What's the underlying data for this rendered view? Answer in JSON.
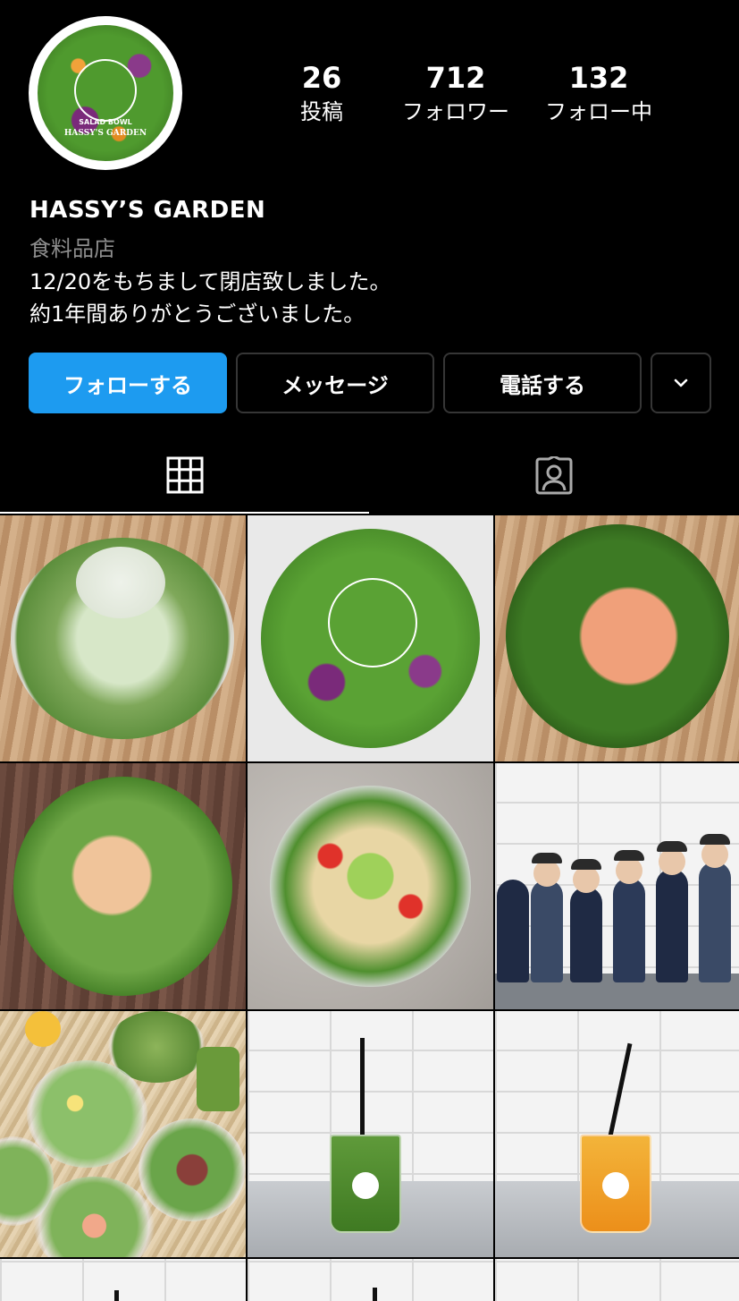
{
  "profile": {
    "avatar_sub": "SALAD BOWL",
    "avatar_name": "HASSY'S GARDEN",
    "name": "HASSY’S GARDEN",
    "category": "食料品店",
    "bio_line1": "12/20をもちまして閉店致しました。",
    "bio_line2": "約1年間ありがとうございました。"
  },
  "stats": [
    {
      "value": "26",
      "label": "投稿"
    },
    {
      "value": "712",
      "label": "フォロワー"
    },
    {
      "value": "132",
      "label": "フォロー中"
    }
  ],
  "buttons": {
    "follow": "フォローする",
    "message": "メッセージ",
    "call": "電話する",
    "more_icon": "chevron-down-icon"
  },
  "tabs": [
    {
      "icon": "grid-icon",
      "active": true
    },
    {
      "icon": "tagged-icon",
      "active": false
    }
  ],
  "colors": {
    "follow_button": "#1d9bf0",
    "background": "#000000",
    "muted_text": "#8e8e8e"
  },
  "posts": [
    {
      "label": "salad-with-cheese"
    },
    {
      "label": "salad-bowl-logo"
    },
    {
      "label": "salmon-salad"
    },
    {
      "label": "chicken-avocado-salad"
    },
    {
      "label": "guacamole-salad"
    },
    {
      "label": "staff-photo"
    },
    {
      "label": "assorted-salads"
    },
    {
      "label": "green-smoothie"
    },
    {
      "label": "orange-smoothie"
    }
  ]
}
